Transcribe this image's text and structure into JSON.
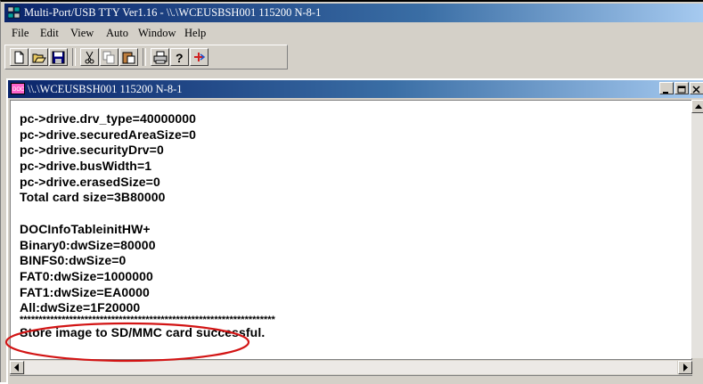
{
  "app": {
    "title": "Multi-Port/USB TTY Ver1.16 - \\\\.\\WCEUSBSH001 115200  N-8-1"
  },
  "menu": [
    "File",
    "Edit",
    "View",
    "Auto",
    "Window",
    "Help"
  ],
  "toolbar": {
    "buttons": [
      "new-icon",
      "open-icon",
      "save-icon",
      "cut-icon",
      "copy-icon",
      "paste-icon",
      "print-icon",
      "help-icon",
      "plugin-icon"
    ]
  },
  "child": {
    "title": "\\\\.\\WCEUSBSH001 115200  N-8-1"
  },
  "terminal": {
    "lines": [
      "pc->drive.drv_type=40000000",
      "pc->drive.securedAreaSize=0",
      "pc->drive.securityDrv=0",
      "pc->drive.busWidth=1",
      "pc->drive.erasedSize=0",
      "Total card size=3B80000",
      "",
      "DOCInfoTableinitHW+",
      "Binary0:dwSize=80000",
      "BINFS0:dwSize=0",
      "FAT0:dwSize=1000000",
      "FAT1:dwSize=EA0000",
      "All:dwSize=1F20000",
      "*******************************************************************",
      "Store image to SD/MMC card successful."
    ]
  },
  "colors": {
    "titlebar_start": "#0a246a",
    "titlebar_end": "#a6caf0",
    "highlight": "#d21414"
  }
}
